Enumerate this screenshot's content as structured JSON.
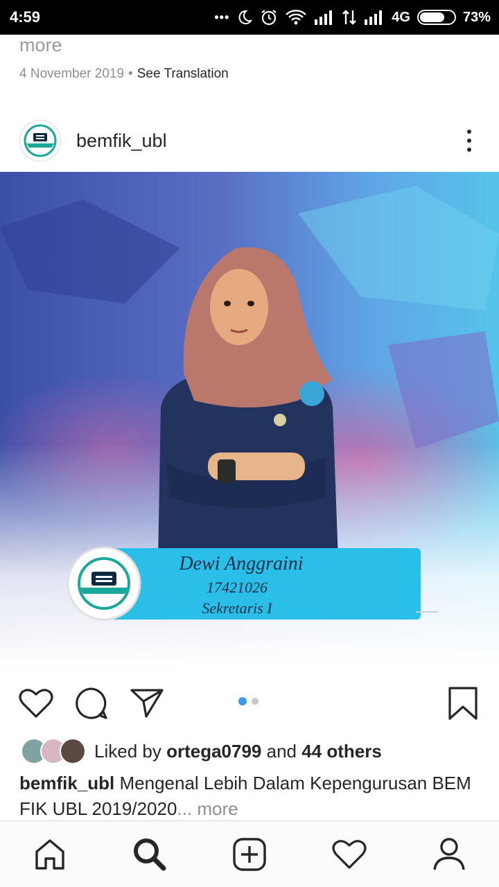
{
  "status_bar": {
    "time": "4:59",
    "dots": "•••",
    "network": "4G",
    "battery": "73%",
    "battery_level": 0.73
  },
  "previous_post": {
    "more_text": "more",
    "date": "4 November 2019",
    "separator": "•",
    "see_translation": "See Translation"
  },
  "post": {
    "username": "bemfik_ubl",
    "avatar_icon": "bem-fik-logo-icon",
    "image": {
      "name": "Dewi Anggraini",
      "id_number": "17421026",
      "role": "Sekretaris I",
      "banner_color": "#29bfe8"
    },
    "carousel": {
      "count": 2,
      "active": 1
    },
    "likes": {
      "prefix": "Liked by",
      "user": "ortega0799",
      "joiner": "and",
      "others": "44 others"
    },
    "caption": {
      "username": "bemfik_ubl",
      "text": "Mengenal Lebih Dalam Kepengurusan BEM FIK UBL 2019/2020",
      "ellipsis": "...",
      "more": "more"
    }
  },
  "bottom_nav": [
    {
      "name": "home",
      "icon": "home-icon"
    },
    {
      "name": "search",
      "icon": "search-icon"
    },
    {
      "name": "new-post",
      "icon": "add-post-icon"
    },
    {
      "name": "activity",
      "icon": "heart-icon"
    },
    {
      "name": "profile",
      "icon": "profile-icon"
    }
  ],
  "colors": {
    "accent_blue": "#3897f0",
    "text": "#262626",
    "muted": "#8e8e8e"
  }
}
